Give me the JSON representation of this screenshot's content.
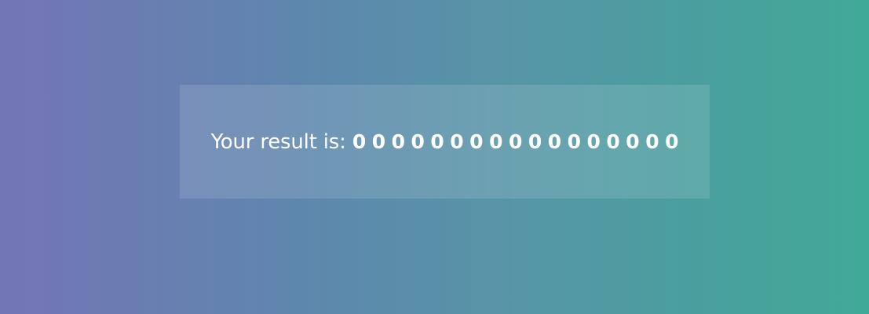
{
  "result": {
    "label": "Your result is:",
    "digits": [
      "0",
      "0",
      "0",
      "0",
      "0",
      "0",
      "0",
      "0",
      "0",
      "0",
      "0",
      "0",
      "0",
      "0",
      "0",
      "0",
      "0"
    ]
  },
  "colors": {
    "gradient_start": "#7475b6",
    "gradient_end": "#41a998",
    "text": "#ffffff"
  }
}
